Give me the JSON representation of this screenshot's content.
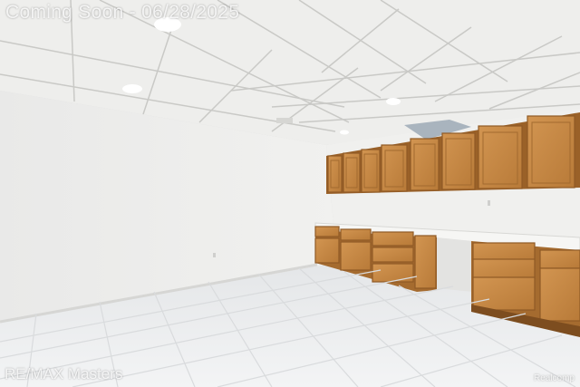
{
  "banner": {
    "text": "Coming Soon - 06/28/2025"
  },
  "watermarks": {
    "brokerage": "RE/MAX Masters",
    "site": "Realcomp"
  },
  "colors": {
    "ceiling": "#eeeeec",
    "ceiling_grid": "#c9c9c6",
    "wall": "#ececea",
    "floor": "#eef0f1",
    "cabinet_wood": "#c58a45",
    "cabinet_dark": "#8f5a26",
    "countertop": "#f4f4f2"
  }
}
